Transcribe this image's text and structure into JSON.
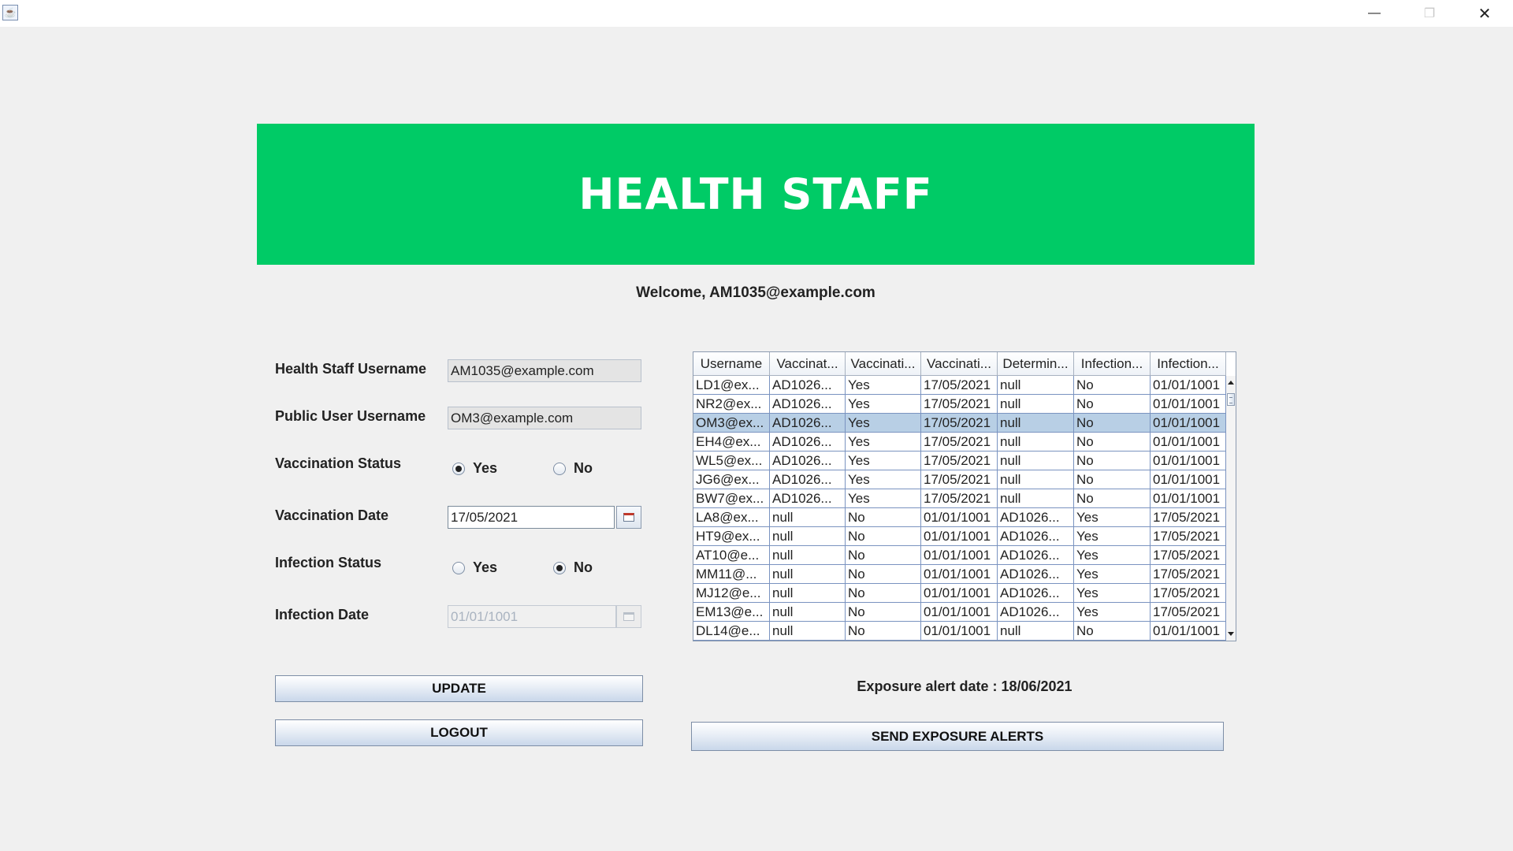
{
  "window": {
    "controls": {
      "minimize": "—",
      "maximize": "❐",
      "close": "✕"
    }
  },
  "header": {
    "title": "HEALTH STAFF",
    "color": "#00cb66"
  },
  "welcome": "Welcome, AM1035@example.com",
  "form": {
    "staff_username_label": "Health Staff Username",
    "staff_username_value": "AM1035@example.com",
    "public_username_label": "Public User Username",
    "public_username_value": "OM3@example.com",
    "vaccination_status_label": "Vaccination Status",
    "vaccination_status": {
      "yes": "Yes",
      "no": "No",
      "selected": "Yes"
    },
    "vaccination_date_label": "Vaccination Date",
    "vaccination_date_value": "17/05/2021",
    "infection_status_label": "Infection Status",
    "infection_status": {
      "yes": "Yes",
      "no": "No",
      "selected": "No"
    },
    "infection_date_label": "Infection Date",
    "infection_date_value": "01/01/1001"
  },
  "buttons": {
    "update": "UPDATE",
    "logout": "LOGOUT",
    "send_alerts": "SEND EXPOSURE ALERTS"
  },
  "table": {
    "columns": [
      "Username",
      "Vaccinat...",
      "Vaccinati...",
      "Vaccinati...",
      "Determin...",
      "Infection...",
      "Infection..."
    ],
    "selected_row": 2,
    "rows": [
      [
        "LD1@ex...",
        "AD1026...",
        "Yes",
        "17/05/2021",
        "null",
        "No",
        "01/01/1001"
      ],
      [
        "NR2@ex...",
        "AD1026...",
        "Yes",
        "17/05/2021",
        "null",
        "No",
        "01/01/1001"
      ],
      [
        "OM3@ex...",
        "AD1026...",
        "Yes",
        "17/05/2021",
        "null",
        "No",
        "01/01/1001"
      ],
      [
        "EH4@ex...",
        "AD1026...",
        "Yes",
        "17/05/2021",
        "null",
        "No",
        "01/01/1001"
      ],
      [
        "WL5@ex...",
        "AD1026...",
        "Yes",
        "17/05/2021",
        "null",
        "No",
        "01/01/1001"
      ],
      [
        "JG6@ex...",
        "AD1026...",
        "Yes",
        "17/05/2021",
        "null",
        "No",
        "01/01/1001"
      ],
      [
        "BW7@ex...",
        "AD1026...",
        "Yes",
        "17/05/2021",
        "null",
        "No",
        "01/01/1001"
      ],
      [
        "LA8@ex...",
        "null",
        "No",
        "01/01/1001",
        "AD1026...",
        "Yes",
        "17/05/2021"
      ],
      [
        "HT9@ex...",
        "null",
        "No",
        "01/01/1001",
        "AD1026...",
        "Yes",
        "17/05/2021"
      ],
      [
        "AT10@e...",
        "null",
        "No",
        "01/01/1001",
        "AD1026...",
        "Yes",
        "17/05/2021"
      ],
      [
        "MM11@...",
        "null",
        "No",
        "01/01/1001",
        "AD1026...",
        "Yes",
        "17/05/2021"
      ],
      [
        "MJ12@e...",
        "null",
        "No",
        "01/01/1001",
        "AD1026...",
        "Yes",
        "17/05/2021"
      ],
      [
        "EM13@e...",
        "null",
        "No",
        "01/01/1001",
        "AD1026...",
        "Yes",
        "17/05/2021"
      ],
      [
        "DL14@e...",
        "null",
        "No",
        "01/01/1001",
        "null",
        "No",
        "01/01/1001"
      ]
    ]
  },
  "exposure_alert": "Exposure alert date : 18/06/2021"
}
